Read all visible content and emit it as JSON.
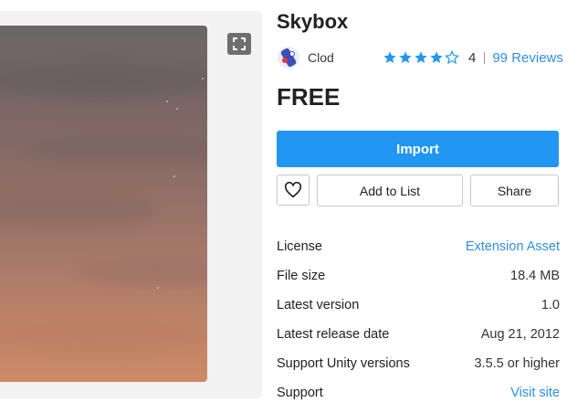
{
  "asset": {
    "title": "Skybox",
    "publisher": "Clod",
    "rating": {
      "stars": 4,
      "value": "4",
      "reviews": "99 Reviews"
    },
    "price": "FREE"
  },
  "actions": {
    "import_label": "Import",
    "add_to_list_label": "Add to List",
    "share_label": "Share"
  },
  "details": [
    {
      "label": "License",
      "value": "Extension Asset",
      "link": true
    },
    {
      "label": "File size",
      "value": "18.4 MB",
      "link": false
    },
    {
      "label": "Latest version",
      "value": "1.0",
      "link": false
    },
    {
      "label": "Latest release date",
      "value": "Aug 21, 2012",
      "link": false
    },
    {
      "label": "Support Unity versions",
      "value": "3.5.5 or higher",
      "link": false
    },
    {
      "label": "Support",
      "value": "Visit site",
      "link": true
    }
  ],
  "icons": {
    "fullscreen": "fullscreen-icon",
    "heart": "heart-icon",
    "star": "star-icon",
    "avatar": "publisher-avatar-icon"
  },
  "colors": {
    "accent": "#2196f3",
    "link": "#2f8fe0",
    "text": "#212121"
  }
}
